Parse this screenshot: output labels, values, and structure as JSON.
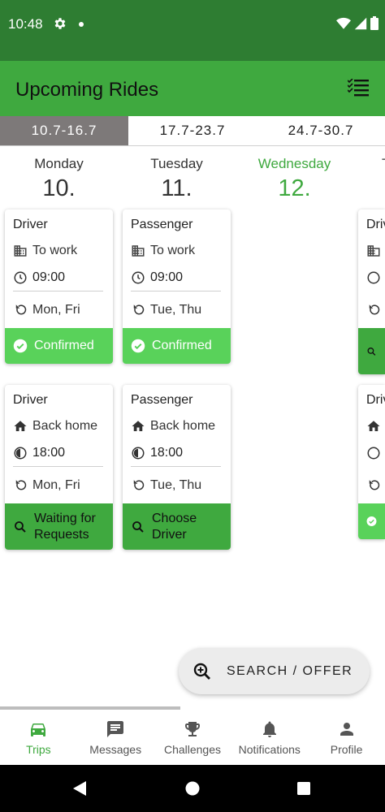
{
  "status_bar": {
    "time": "10:48"
  },
  "app_bar": {
    "title": "Upcoming Rides"
  },
  "week_tabs": [
    "10.7-16.7",
    "17.7-23.7",
    "24.7-30.7"
  ],
  "days": [
    {
      "name": "Monday",
      "number": "10."
    },
    {
      "name": "Tuesday",
      "number": "11."
    },
    {
      "name": "Wednesday",
      "number": "12."
    }
  ],
  "cards": {
    "mon_morning": {
      "role": "Driver",
      "destination": "To work",
      "time": "09:00",
      "repeat": "Mon, Fri",
      "status": "Confirmed"
    },
    "tue_morning": {
      "role": "Passenger",
      "destination": "To work",
      "time": "09:00",
      "repeat": "Tue, Thu",
      "status": "Confirmed"
    },
    "mon_evening": {
      "role": "Driver",
      "destination": "Back home",
      "time": "18:00",
      "repeat": "Mon, Fri",
      "status_line1": "Waiting for",
      "status_line2": "Requests"
    },
    "tue_evening": {
      "role": "Passenger",
      "destination": "Back home",
      "time": "18:00",
      "repeat": "Tue, Thu",
      "status_line1": "Choose",
      "status_line2": "Driver"
    },
    "partial_top": {
      "role": "Driv"
    },
    "partial_bottom": {
      "role": "Driv"
    }
  },
  "fab": {
    "label": "SEARCH / OFFER"
  },
  "bottom_nav": [
    "Trips",
    "Messages",
    "Challenges",
    "Notifications",
    "Profile"
  ],
  "colors": {
    "primary": "#3fa93f",
    "status_bar": "#2e7d32",
    "confirmed": "#59d25a",
    "tab_active": "#7d7979"
  }
}
